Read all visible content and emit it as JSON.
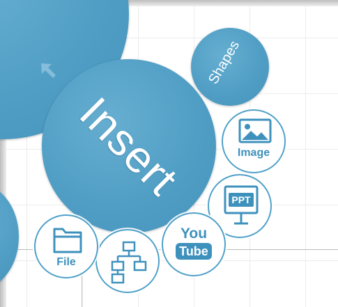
{
  "menu": {
    "center_label": "Insert",
    "shapes_label": "Shapes",
    "items": [
      {
        "label": "Image",
        "icon": "image-icon"
      },
      {
        "label": "PPT",
        "icon": "presentation-icon"
      },
      {
        "label": "You",
        "label2": "Tube",
        "icon": "youtube-icon"
      },
      {
        "label": "",
        "icon": "org-chart-icon"
      },
      {
        "label": "File",
        "icon": "folder-icon"
      }
    ]
  },
  "colors": {
    "accent": "#4f9dc4",
    "icon": "#3e91bd",
    "background": "#ffffff",
    "grid": "#ececec"
  }
}
